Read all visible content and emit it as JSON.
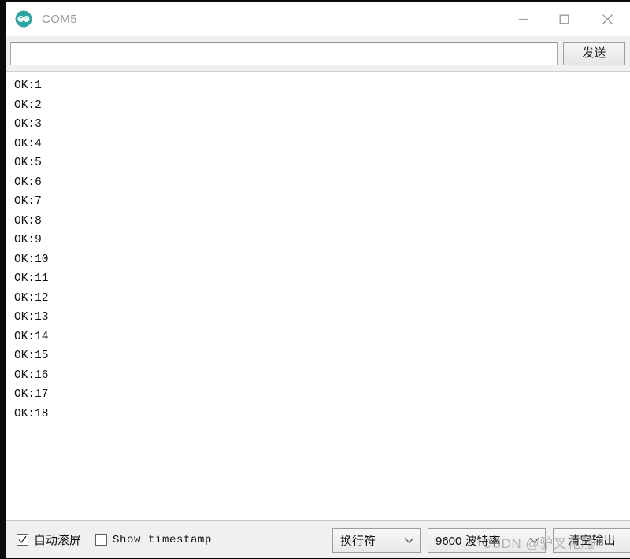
{
  "window": {
    "title": "COM5",
    "app_icon": "arduino-infinity-icon",
    "accent": "#2fa3a0",
    "controls": {
      "minimize": "minimize-icon",
      "maximize": "maximize-icon",
      "close": "close-icon"
    }
  },
  "send_bar": {
    "input_value": "",
    "input_placeholder": "",
    "send_label": "发送"
  },
  "console": {
    "lines": [
      "OK:1",
      "OK:2",
      "OK:3",
      "OK:4",
      "OK:5",
      "OK:6",
      "OK:7",
      "OK:8",
      "OK:9",
      "OK:10",
      "OK:11",
      "OK:12",
      "OK:13",
      "OK:14",
      "OK:15",
      "OK:16",
      "OK:17",
      "OK:18"
    ]
  },
  "status_bar": {
    "autoscroll": {
      "label": "自动滚屏",
      "checked": true
    },
    "timestamp": {
      "label": "Show timestamp",
      "checked": false
    },
    "line_ending": {
      "value": "换行符"
    },
    "baud_rate": {
      "value": "9600 波特率"
    },
    "clear_button": {
      "label": "清空输出"
    }
  },
  "watermark": {
    "text": "CSDN @驴叉花雕"
  }
}
